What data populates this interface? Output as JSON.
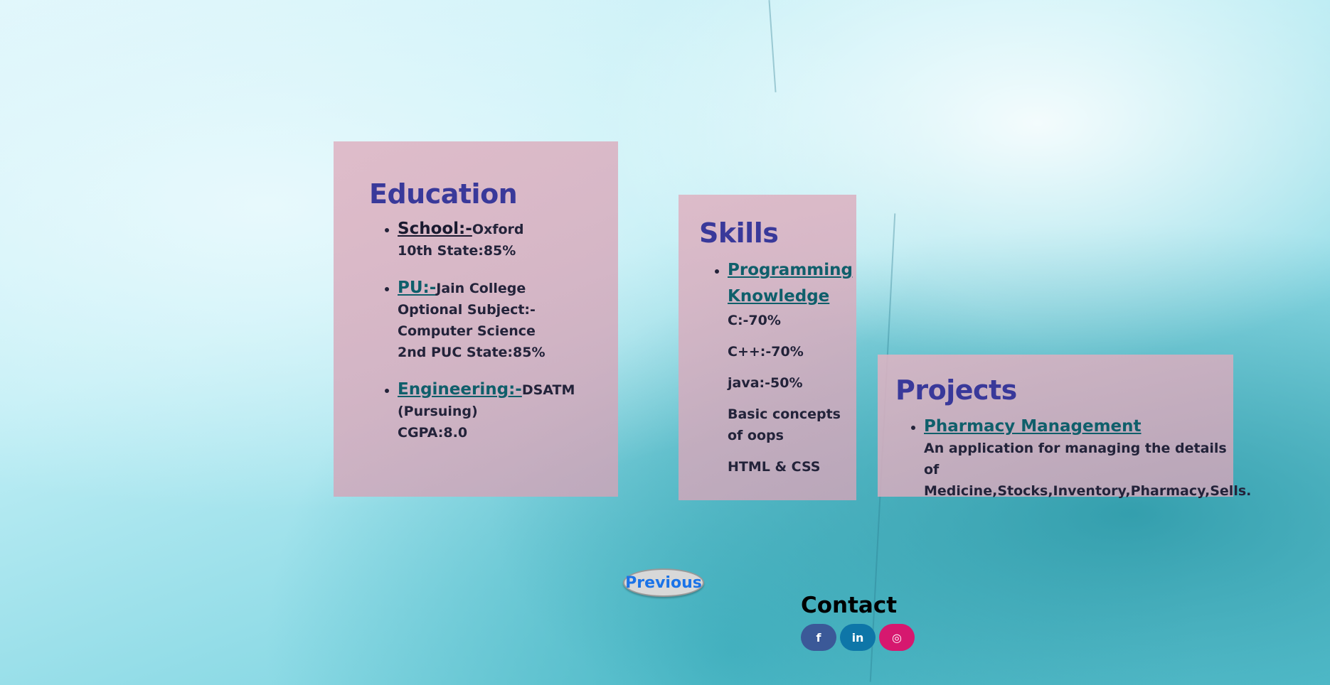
{
  "education": {
    "title": "Education",
    "items": [
      {
        "label": "School:-",
        "detail": "Oxford",
        "lines": [
          "10th State:85%"
        ]
      },
      {
        "label": "PU:-",
        "detail": "Jain College",
        "lines": [
          "Optional Subject:-",
          "Computer Science",
          "2nd PUC State:85%"
        ]
      },
      {
        "label": "Engineering:-",
        "detail": "DSATM",
        "lines": [
          "(Pursuing)",
          "CGPA:8.0"
        ]
      }
    ]
  },
  "skills": {
    "title": "Skills",
    "link_line1": "Programming",
    "link_line2": "Knowledge",
    "items": [
      "C:-70%",
      "C++:-70%",
      "java:-50%",
      "Basic concepts",
      "of oops",
      "HTML & CSS"
    ]
  },
  "projects": {
    "title": "Projects",
    "link": "Pharmacy Management",
    "desc1": "An application for managing the details of",
    "desc2": "Medicine,Stocks,Inventory,Pharmacy,Sells."
  },
  "nav": {
    "previous_label": "Previous"
  },
  "contact": {
    "title": "Contact",
    "facebook": "f",
    "linkedin": "in",
    "instagram": "◎"
  },
  "colors": {
    "heading": "#39399a",
    "link": "#0f5f6b",
    "facebook": "#3b5998",
    "linkedin": "#0e76a8",
    "instagram": "#d6186f"
  }
}
